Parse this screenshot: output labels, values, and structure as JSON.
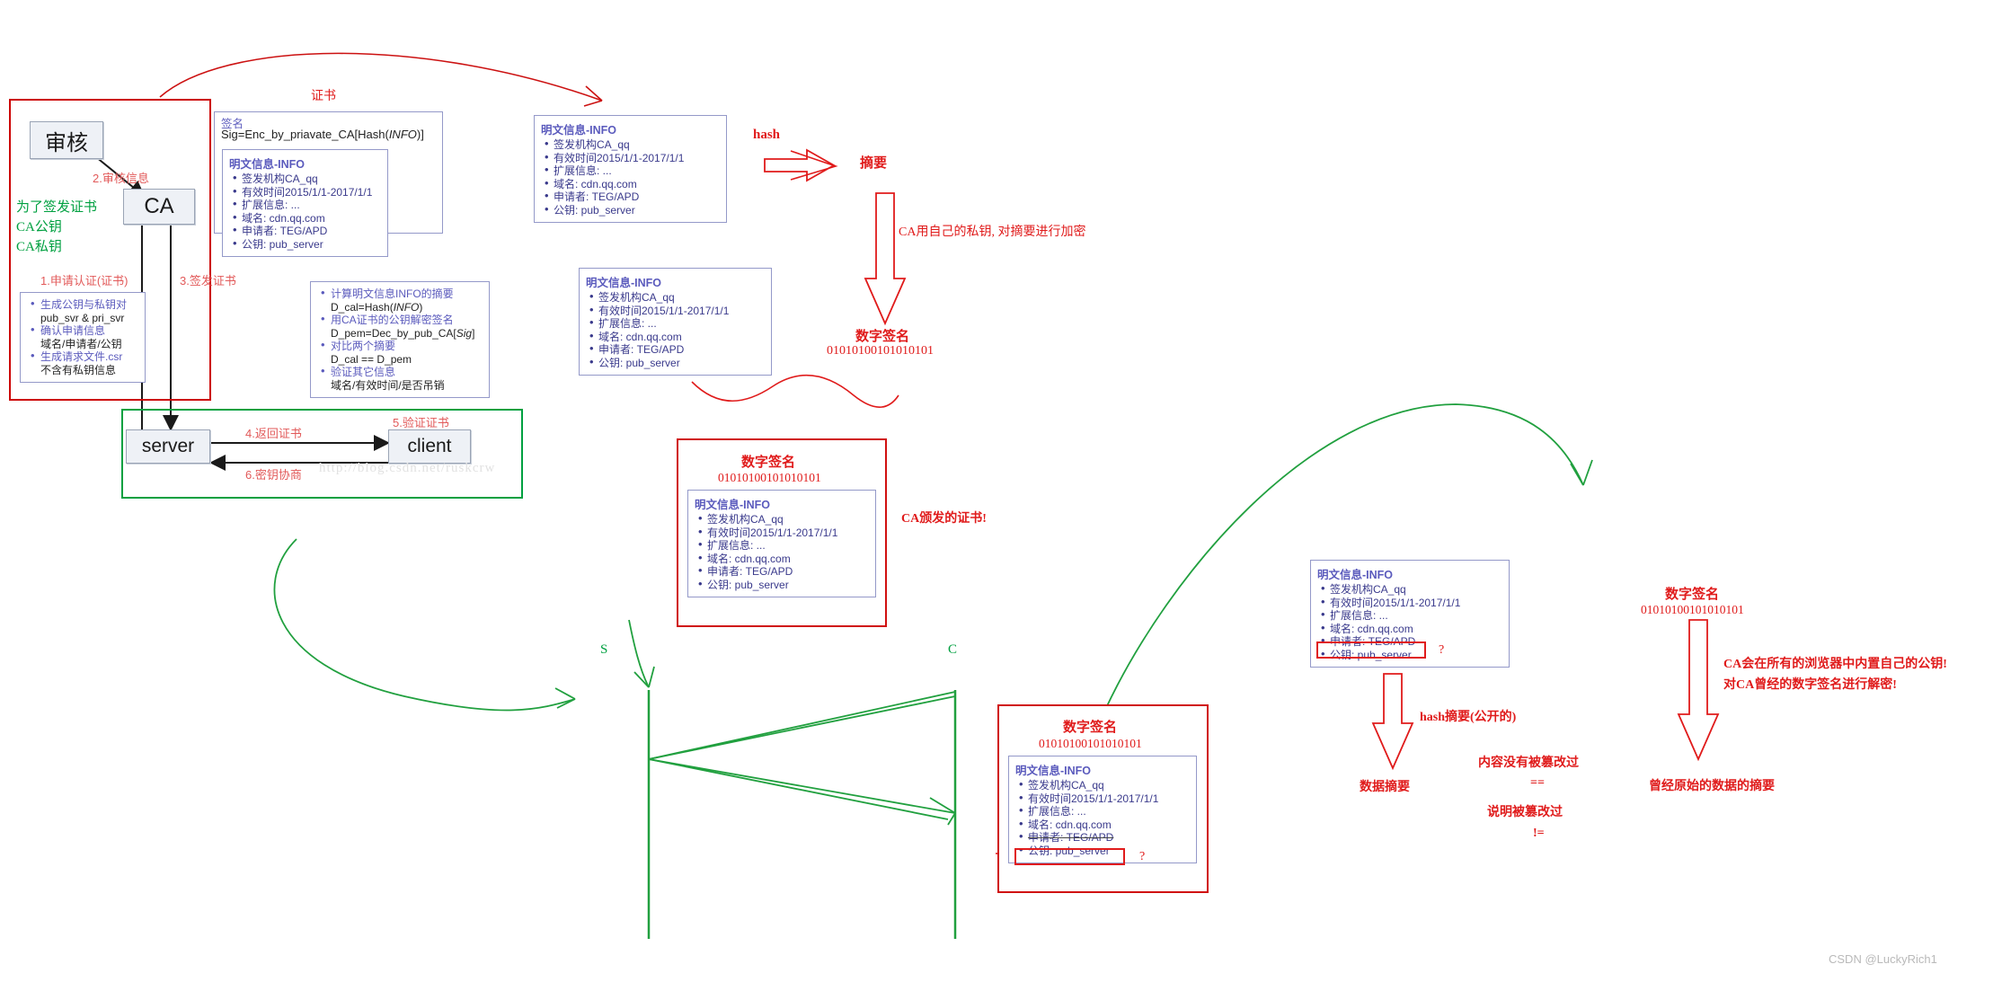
{
  "meta": {
    "watermark": "CSDN @LuckyRich1",
    "inner_watermark": "http://blog.csdn.net/ruskcrw"
  },
  "info_card": {
    "title": "明文信息-INFO",
    "items": [
      "签发机构CA_qq",
      "有效时间2015/1/1-2017/1/1",
      "扩展信息: ...",
      "域名: cdn.qq.com",
      "申请者: TEG/APD",
      "公钥: pub_server"
    ]
  },
  "ca_panel": {
    "review_node": "审核",
    "ca_node": "CA",
    "step2": "2.审核信息",
    "step1": "1.申请认证(证书)",
    "step3": "3.签发证书",
    "green_notes": [
      "为了签发证书",
      "CA公钥",
      "CA私钥"
    ],
    "csr_card": {
      "items": [
        {
          "head": "生成公钥与私钥对",
          "sub": "pub_svr & pri_svr"
        },
        {
          "head": "确认申请信息",
          "sub": "域名/申请者/公钥"
        },
        {
          "head": "生成请求文件.csr",
          "sub": "不含有私钥信息"
        }
      ]
    }
  },
  "cert_panel": {
    "label": "证书",
    "sig_head": "签名",
    "sig_formula_pre": "Sig=Enc_by_priavate_CA[Hash(",
    "sig_formula_em": "INFO",
    "sig_formula_post": ")]"
  },
  "verify_card": {
    "items": [
      {
        "head": "计算明文信息INFO的摘要",
        "sub_pre": "D_cal=Hash(",
        "sub_em": "INFO",
        "sub_post": ")"
      },
      {
        "head": "用CA证书的公钥解密签名",
        "sub_pre": "D_pem=Dec_by_pub_CA[",
        "sub_em": "Sig",
        "sub_post": "]"
      },
      {
        "head": "对比两个摘要",
        "sub_pre": "D_cal == D_pem",
        "sub_em": "",
        "sub_post": ""
      },
      {
        "head": "验证其它信息",
        "sub_pre": "域名/有效时间/是否吊销",
        "sub_em": "",
        "sub_post": ""
      }
    ]
  },
  "sc_panel": {
    "server_node": "server",
    "client_node": "client",
    "step4": "4.返回证书",
    "step5": "5.验证证书",
    "step6": "6.密钥协商"
  },
  "hash_flow": {
    "hash_label": "hash",
    "digest_label": "摘要",
    "ca_private_note": "CA用自己的私钥, 对摘要进行加密",
    "digital_signature_title": "数字签名",
    "digital_signature_bits": "01010100101010101"
  },
  "cert_issued": {
    "title": "数字签名",
    "bits": "01010100101010101",
    "note": "CA颁发的证书!"
  },
  "timeline": {
    "s_label": "S",
    "c_label": "C"
  },
  "client_cert": {
    "title": "数字签名",
    "bits": "01010100101010101",
    "question_mark": "?"
  },
  "right_verify": {
    "question_mark": "?",
    "hash_note": "hash摘要(公开的)",
    "data_digest": "数据摘要",
    "eq_note_top": "内容没有被篡改过",
    "eq_sign": "==",
    "neq_note": "说明被篡改过",
    "neq_sign": "!=",
    "ds_title": "数字签名",
    "ds_bits": "01010100101010101",
    "ca_note_1": "CA会在所有的浏览器中内置自己的公钥!",
    "ca_note_2": "对CA曾经的数字签名进行解密!",
    "original_digest": "曾经原始的数据的摘要"
  },
  "colors": {
    "red": "#e01b1b",
    "green": "#00a040",
    "card_blue": "#5b5bbd",
    "step_red": "#e25a5a"
  }
}
